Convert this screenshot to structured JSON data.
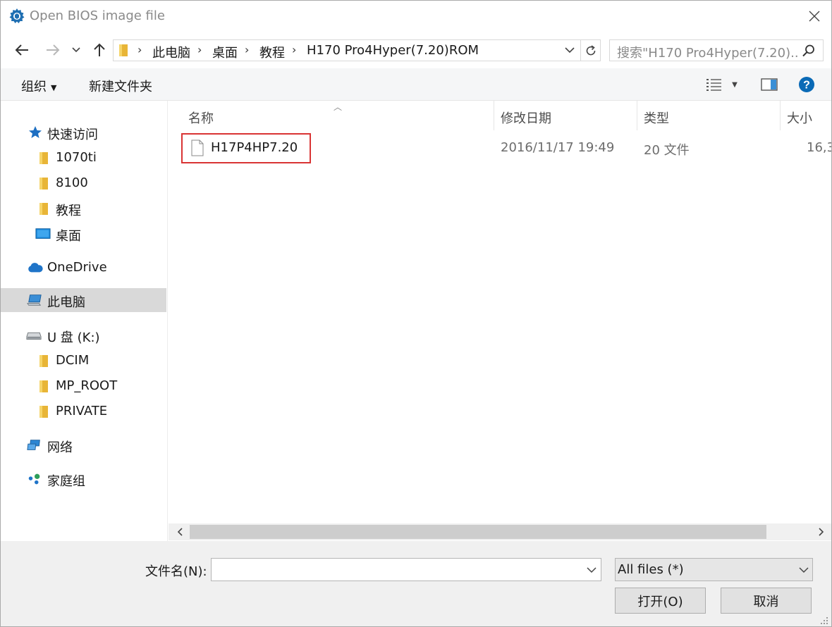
{
  "window": {
    "title": "Open BIOS image file",
    "accent": "#0a6ab6",
    "highlight_color": "#d93434"
  },
  "nav": {
    "back": "back-arrow",
    "forward": "forward-arrow",
    "recent": "chevron-down",
    "up": "up-arrow"
  },
  "address": {
    "crumbs": [
      "此电脑",
      "桌面",
      "教程",
      "H170 Pro4Hyper(7.20)ROM"
    ]
  },
  "search": {
    "placeholder": "搜索\"H170 Pro4Hyper(7.20)..."
  },
  "toolbar": {
    "organize_label": "组织",
    "new_folder_label": "新建文件夹"
  },
  "sidebar": {
    "items": [
      {
        "label": "快速访问",
        "icon": "star-icon"
      },
      {
        "label": "1070ti",
        "icon": "folder-icon"
      },
      {
        "label": "8100",
        "icon": "folder-icon"
      },
      {
        "label": "教程",
        "icon": "folder-icon"
      },
      {
        "label": "桌面",
        "icon": "desktop-icon"
      },
      {
        "label": "OneDrive",
        "icon": "cloud-icon"
      },
      {
        "label": "此电脑",
        "icon": "computer-icon",
        "selected": true
      },
      {
        "label": "U 盘 (K:)",
        "icon": "drive-icon"
      },
      {
        "label": "DCIM",
        "icon": "folder-icon"
      },
      {
        "label": "MP_ROOT",
        "icon": "folder-icon"
      },
      {
        "label": "PRIVATE",
        "icon": "folder-icon"
      },
      {
        "label": "网络",
        "icon": "network-icon"
      },
      {
        "label": "家庭组",
        "icon": "homegroup-icon"
      }
    ]
  },
  "files": {
    "columns": [
      "名称",
      "修改日期",
      "类型",
      "大小"
    ],
    "rows": [
      {
        "name": "H17P4HP7.20",
        "modified": "2016/11/17 19:49",
        "type": "20 文件",
        "size": "16,3"
      }
    ]
  },
  "footer": {
    "filename_label": "文件名(N):",
    "filename_value": "",
    "filter_value": "All files (*)",
    "open_label": "打开(O)",
    "cancel_label": "取消"
  }
}
